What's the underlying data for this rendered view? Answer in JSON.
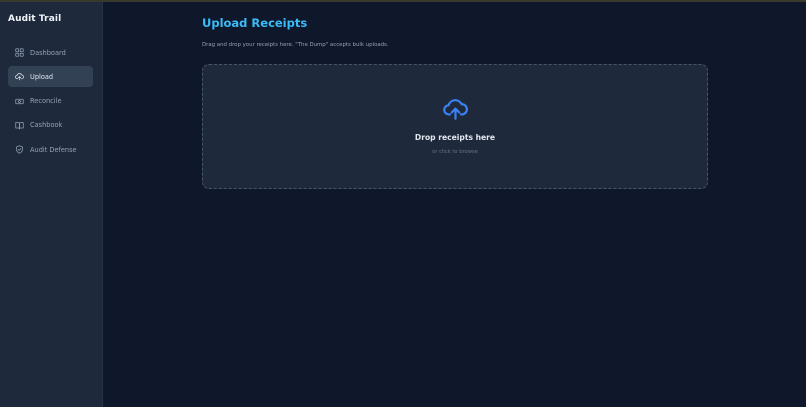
{
  "app": {
    "title": "Audit Trail"
  },
  "sidebar": {
    "items": [
      {
        "label": "Dashboard",
        "icon": "dashboard-icon",
        "active": false
      },
      {
        "label": "Upload",
        "icon": "cloud-upload-icon",
        "active": true
      },
      {
        "label": "Reconcile",
        "icon": "reconcile-icon",
        "active": false
      },
      {
        "label": "Cashbook",
        "icon": "book-icon",
        "active": false
      },
      {
        "label": "Audit Defense",
        "icon": "shield-icon",
        "active": false
      }
    ]
  },
  "main": {
    "title": "Upload Receipts",
    "subtitle": "Drag and drop your receipts here. \"The Dump\" accepts bulk uploads.",
    "dropzone": {
      "icon": "cloud-upload-icon",
      "title": "Drop receipts here",
      "hint": "or click to browse"
    }
  },
  "colors": {
    "background": "#0f172a",
    "sidebar": "#1e293b",
    "accent_title": "#38bdf8",
    "upload_icon": "#3b82f6",
    "active_item": "#334155"
  }
}
